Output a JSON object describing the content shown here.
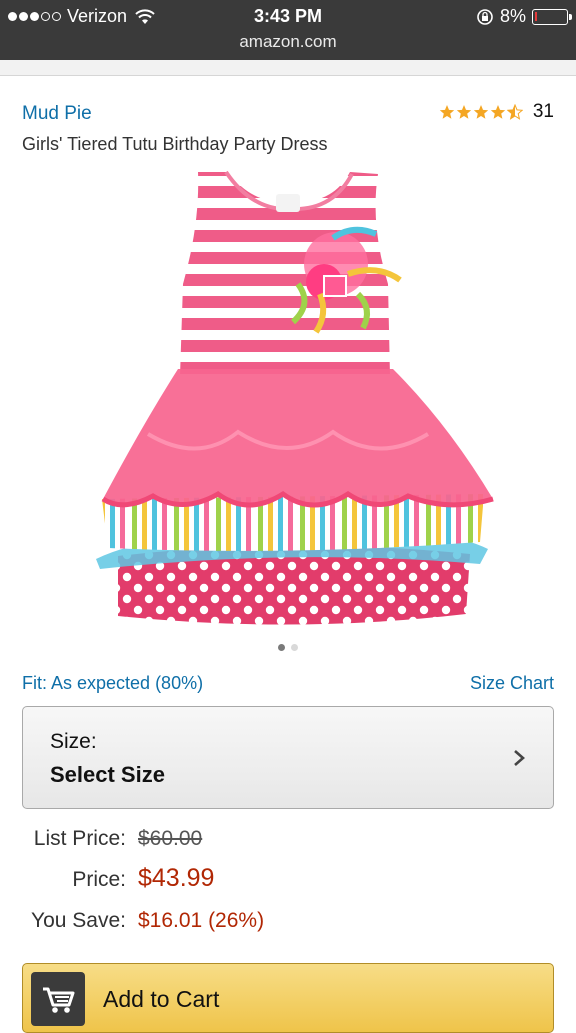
{
  "status_bar": {
    "carrier": "Verizon",
    "time": "3:43 PM",
    "battery": "8%",
    "battery_level": 0.08,
    "url": "amazon.com"
  },
  "product": {
    "brand": "Mud Pie",
    "title": "Girls' Tiered Tutu Birthday Party Dress",
    "rating": 4.5,
    "rating_count": "31",
    "image_count": 2,
    "image_active_index": 0
  },
  "fit": {
    "text": "Fit: As expected (80%)",
    "size_chart": "Size Chart"
  },
  "size_selector": {
    "label": "Size:",
    "value": "Select Size"
  },
  "pricing": {
    "list_label": "List Price:",
    "list_value": "$60.00",
    "price_label": "Price:",
    "price_value": "$43.99",
    "save_label": "You Save:",
    "save_value": "$16.01 (26%)"
  },
  "cart": {
    "label": "Add to Cart"
  },
  "colors": {
    "link": "#0f6fa8",
    "price": "#b12704",
    "star": "#f4a623",
    "button": "#efc44a"
  }
}
